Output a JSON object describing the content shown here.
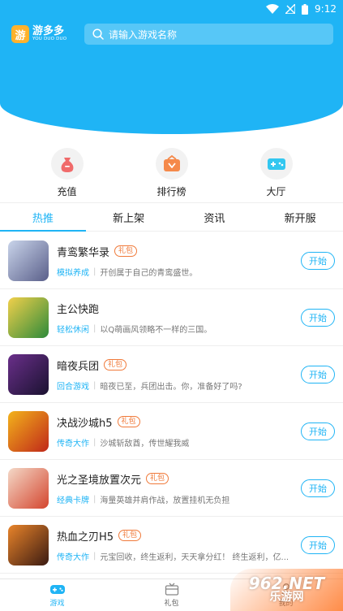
{
  "status_bar": {
    "time": "9:12"
  },
  "app": {
    "logo_badge": "游",
    "name": "游多多",
    "name_en": "YOU DUO DUO"
  },
  "search": {
    "placeholder": "请输入游戏名称"
  },
  "categories": [
    {
      "label": "充值",
      "icon": "money-bag-icon",
      "color": "#f06a6a"
    },
    {
      "label": "排行榜",
      "icon": "ranking-icon",
      "color": "#f5894a"
    },
    {
      "label": "大厅",
      "icon": "gamepad-icon",
      "color": "#33c7f0"
    }
  ],
  "tabs": [
    "热推",
    "新上架",
    "资讯",
    "新开服"
  ],
  "active_tab": 0,
  "games": [
    {
      "title": "青鸾繁华录",
      "gift": "礼包",
      "genre": "模拟养成",
      "desc": "开创属于自己的青鸾盛世。",
      "button": "开始",
      "thumb_colors": [
        "#c9d4ea",
        "#5a5f8a"
      ]
    },
    {
      "title": "主公快跑",
      "gift": "",
      "genre": "轻松休闲",
      "desc": "以Q萌画风领略不一样的三国。",
      "button": "开始",
      "thumb_colors": [
        "#f2d04b",
        "#2d8a3a"
      ]
    },
    {
      "title": "暗夜兵团",
      "gift": "礼包",
      "genre": "回合游戏",
      "desc": "暗夜已至，兵团出击。你，准备好了吗?",
      "button": "开始",
      "thumb_colors": [
        "#6a2f8a",
        "#1a1230"
      ]
    },
    {
      "title": "决战沙城h5",
      "gift": "礼包",
      "genre": "传奇大作",
      "desc": "沙城斩敌酋，传世耀我威",
      "button": "开始",
      "thumb_colors": [
        "#f3b31b",
        "#c0281a"
      ]
    },
    {
      "title": "光之圣境放置次元",
      "gift": "礼包",
      "genre": "经典卡牌",
      "desc": "海量英雄并肩作战，放置挂机无负担",
      "button": "开始",
      "thumb_colors": [
        "#f4d9c8",
        "#d4452e"
      ]
    },
    {
      "title": "热血之刃H5",
      "gift": "礼包",
      "genre": "传奇大作",
      "desc": "元宝回收，终生返利，天天拿分红！ 终生返利，亿...",
      "button": "开始",
      "thumb_colors": [
        "#e9842a",
        "#3a1a12"
      ]
    }
  ],
  "bottom_nav": [
    {
      "label": "游戏",
      "icon": "game-controller-icon"
    },
    {
      "label": "礼包",
      "icon": "gift-box-icon"
    },
    {
      "label": "我的",
      "icon": "user-icon"
    }
  ],
  "watermark": {
    "top": "962.NET",
    "bottom": "乐游网"
  }
}
